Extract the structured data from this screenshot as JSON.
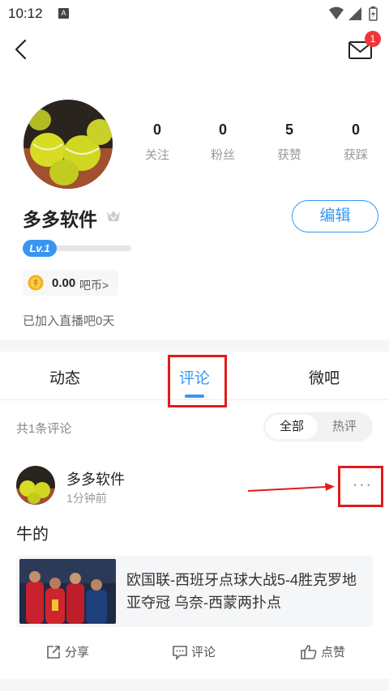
{
  "status_bar": {
    "time": "10:12",
    "notif_icon": "A"
  },
  "header": {
    "mail_badge": "1"
  },
  "profile": {
    "stats": [
      {
        "value": "0",
        "label": "关注"
      },
      {
        "value": "0",
        "label": "粉丝"
      },
      {
        "value": "5",
        "label": "获赞"
      },
      {
        "value": "0",
        "label": "获踩"
      }
    ],
    "username": "多多软件",
    "edit_label": "编辑",
    "level": "Lv.1",
    "level_progress": 0.0,
    "coin_value": "0.00",
    "coin_unit": "吧币>",
    "joined_text": "已加入直播吧0天"
  },
  "tabs": [
    {
      "label": "动态"
    },
    {
      "label": "评论"
    },
    {
      "label": "微吧"
    }
  ],
  "comments_header": {
    "count_text": "共1条评论",
    "sort_options": [
      "全部",
      "热评"
    ]
  },
  "comment": {
    "author": "多多软件",
    "time": "1分钟前",
    "more": "···",
    "body": "牛的",
    "link_title": "欧国联-西班牙点球大战5-4胜克罗地亚夺冠 乌奈-西蒙两扑点"
  },
  "actions": {
    "share": "分享",
    "comment": "评论",
    "like": "点赞"
  },
  "colors": {
    "accent": "#3896f2",
    "annotation_red": "#e21b1b",
    "badge_red": "#f2353a"
  }
}
